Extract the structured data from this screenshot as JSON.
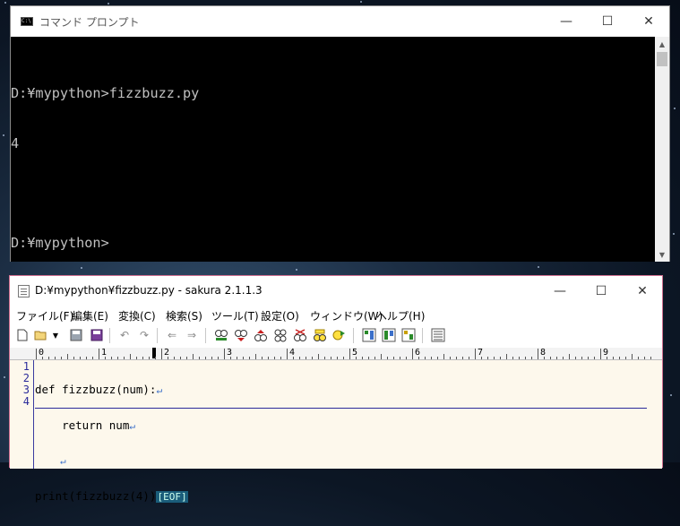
{
  "cmd_window": {
    "title": "コマンド プロンプト",
    "icon": "cmd-icon",
    "icon_text": "C:\\",
    "controls": {
      "minimize": "—",
      "maximize": "☐",
      "close": "✕"
    },
    "lines": [
      "D:¥mypython>fizzbuzz.py",
      "4",
      "",
      "D:¥mypython>"
    ]
  },
  "sakura_window": {
    "title": "D:¥mypython¥fizzbuzz.py - sakura 2.1.1.3",
    "controls": {
      "minimize": "—",
      "maximize": "☐",
      "close": "✕"
    },
    "menu": [
      "ファイル(F)",
      "編集(E)",
      "変換(C)",
      "検索(S)",
      "ツール(T)",
      "設定(O)",
      "ウィンドウ(W)",
      "ヘルプ(H)"
    ],
    "toolbar_icons": [
      "new-file-icon",
      "open-file-icon",
      "dropdown-arrow-icon",
      "save-icon",
      "save-all-icon",
      "undo-icon",
      "redo-icon",
      "jump-back-icon",
      "jump-forward-icon",
      "find-icon",
      "find-next-icon",
      "find-prev-icon",
      "replace-icon",
      "grep-icon",
      "bookmark-icon",
      "bookmark-next-icon",
      "outline-icon",
      "compare-icon",
      "format-icon",
      "settings-icon"
    ],
    "ruler_numbers": [
      "0",
      "1",
      "2",
      "3",
      "4",
      "5",
      "6",
      "7",
      "8",
      "9"
    ],
    "line_numbers": [
      "1",
      "2",
      "3",
      "4"
    ],
    "code_lines": [
      "def fizzbuzz(num):",
      "    return num",
      "",
      "print(fizzbuzz(4))"
    ],
    "crlf_marker": "↵",
    "eof_marker": "[EOF]"
  },
  "colors": {
    "console_bg": "#000000",
    "console_text": "#c0c0c0",
    "editor_bg": "#fdf8ec",
    "line_number_color": "#2a2a9a",
    "eof_bg": "#1a5d7a"
  }
}
